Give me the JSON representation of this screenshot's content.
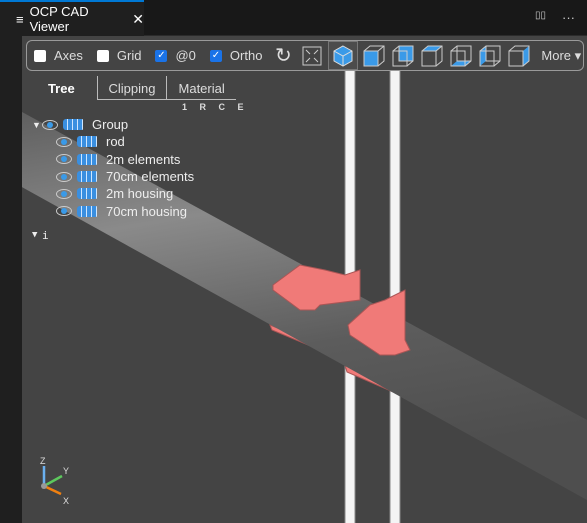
{
  "tab": {
    "title": "OCP CAD Viewer",
    "close": "✕",
    "split_icon": "▯▯",
    "more_icon": "···"
  },
  "toolbar": {
    "axes": "Axes",
    "grid": "Grid",
    "zero": "@0",
    "ortho": "Ortho",
    "more": "More ▾",
    "checks": {
      "axes": false,
      "grid": false,
      "zero": true,
      "ortho": true
    }
  },
  "panel_tabs": [
    "Tree",
    "Clipping",
    "Material"
  ],
  "rce": "1 R C E",
  "tree": {
    "root": "Group",
    "children": [
      "rod",
      "2m elements",
      "70cm elements",
      "2m housing",
      "70cm housing"
    ],
    "info": "i"
  },
  "axes_labels": {
    "x": "X",
    "y": "Y",
    "z": "Z"
  },
  "colors": {
    "accent": "#1a73e8",
    "housing": "#f07a78",
    "background": "#444444"
  }
}
